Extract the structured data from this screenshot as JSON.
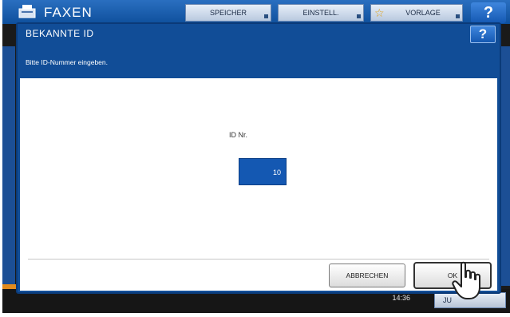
{
  "app": {
    "title": "FAXEN",
    "buttons": {
      "speicher": "SPEICHER",
      "einstell": "EINSTELL.",
      "vorlage": "VORLAGE",
      "help": "?"
    },
    "icons": {
      "app": "fax-icon",
      "vorlage": "star-icon"
    },
    "clock": {
      "line1": "",
      "time": "14:36"
    },
    "bottom_button": "JU"
  },
  "dialog": {
    "title": "BEKANNTE ID",
    "help": "?",
    "instruction": "Bitte ID-Nummer eingeben.",
    "id_label": "ID Nr.",
    "id_value": "10",
    "cancel_label": "ABBRECHEN",
    "ok_label": "OK"
  },
  "colors": {
    "dialog_blue": "#114d97",
    "field_blue": "#1458b2",
    "accent_orange": "#e38b1d"
  }
}
